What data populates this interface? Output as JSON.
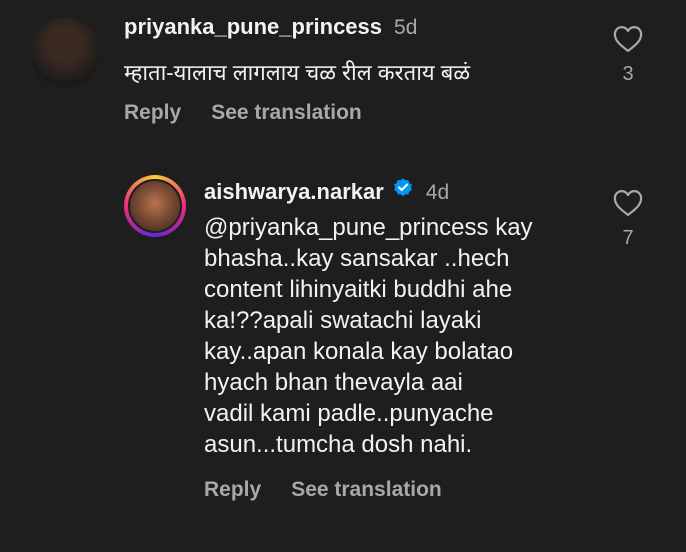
{
  "comments": [
    {
      "username": "priyanka_pune_princess",
      "timestamp": "5d",
      "text": "म्हाता-यालाच लागलाय चळ  रील करताय बळं",
      "reply_label": "Reply",
      "translate_label": "See translation",
      "like_count": "3",
      "verified": false
    },
    {
      "username": "aishwarya.narkar",
      "timestamp": "4d",
      "text": "@priyanka_pune_princess kay\nbhasha..kay sansakar ..hech\ncontent lihinyaitki buddhi ahe\nka!??apali swatachi layaki\nkay..apan konala kay bolatao\nhyach bhan thevayla aai\nvadil kami padle..punyache\nasun...tumcha dosh nahi.",
      "reply_label": "Reply",
      "translate_label": "See translation",
      "like_count": "7",
      "verified": true
    }
  ],
  "colors": {
    "background": "#1e1e1e",
    "text": "#f2f2f2",
    "muted": "#a8a8a8",
    "verified": "#0095f6"
  },
  "icons": {
    "like": "heart-outline-icon",
    "verified": "verified-badge-icon"
  }
}
